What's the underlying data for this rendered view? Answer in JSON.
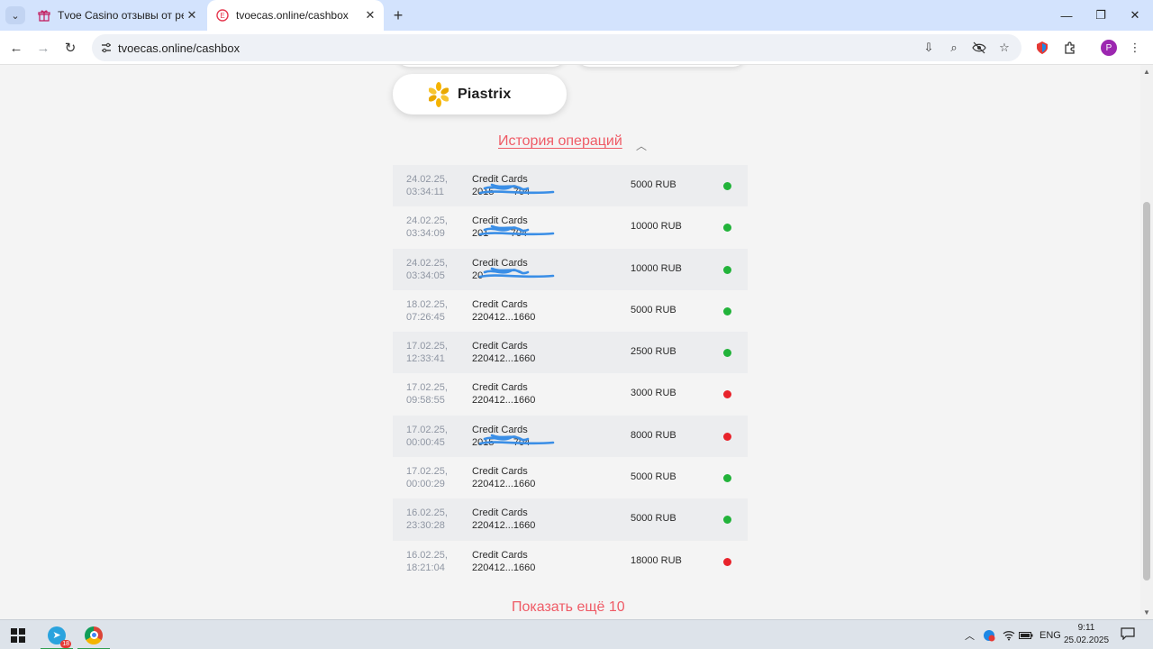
{
  "browser": {
    "tabs": [
      {
        "title": "Tvoe Casino отзывы от реальных игроков",
        "favicon": "gift-favicon",
        "active": false
      },
      {
        "title": "tvoecas.online/cashbox",
        "favicon": "casino-favicon",
        "active": true
      }
    ],
    "url": "tvoecas.online/cashbox",
    "profile_initial": "P"
  },
  "page": {
    "payment_method": "Piastrix",
    "history_title": "История операций",
    "show_more": "Показать ещё 10",
    "operations": [
      {
        "date": "24.02.25,",
        "time": "03:34:11",
        "method": "Credit Cards",
        "card": "2015       704",
        "amount": "5000 RUB",
        "status": "success",
        "redacted": true
      },
      {
        "date": "24.02.25,",
        "time": "03:34:09",
        "method": "Credit Cards",
        "card": "201        704",
        "amount": "10000 RUB",
        "status": "success",
        "redacted": true
      },
      {
        "date": "24.02.25,",
        "time": "03:34:05",
        "method": "Credit Cards",
        "card": "20",
        "amount": "10000 RUB",
        "status": "success",
        "redacted": true
      },
      {
        "date": "18.02.25,",
        "time": "07:26:45",
        "method": "Credit Cards",
        "card": "220412...1660",
        "amount": "5000 RUB",
        "status": "success",
        "redacted": false
      },
      {
        "date": "17.02.25,",
        "time": "12:33:41",
        "method": "Credit Cards",
        "card": "220412...1660",
        "amount": "2500 RUB",
        "status": "success",
        "redacted": false
      },
      {
        "date": "17.02.25,",
        "time": "09:58:55",
        "method": "Credit Cards",
        "card": "220412...1660",
        "amount": "3000 RUB",
        "status": "failed",
        "redacted": false
      },
      {
        "date": "17.02.25,",
        "time": "00:00:45",
        "method": "Credit Cards",
        "card": "2015       704",
        "amount": "8000 RUB",
        "status": "failed",
        "redacted": true
      },
      {
        "date": "17.02.25,",
        "time": "00:00:29",
        "method": "Credit Cards",
        "card": "220412...1660",
        "amount": "5000 RUB",
        "status": "success",
        "redacted": false
      },
      {
        "date": "16.02.25,",
        "time": "23:30:28",
        "method": "Credit Cards",
        "card": "220412...1660",
        "amount": "5000 RUB",
        "status": "success",
        "redacted": false
      },
      {
        "date": "16.02.25,",
        "time": "18:21:04",
        "method": "Credit Cards",
        "card": "220412...1660",
        "amount": "18000 RUB",
        "status": "failed",
        "redacted": false
      }
    ]
  },
  "taskbar": {
    "telegram_badge": "18",
    "language": "ENG",
    "time": "9:11",
    "date": "25.02.2025"
  },
  "colors": {
    "success": "#22b33a",
    "failed": "#e8232b",
    "accent": "#ef5b66",
    "redaction": "#3a8ee6"
  }
}
